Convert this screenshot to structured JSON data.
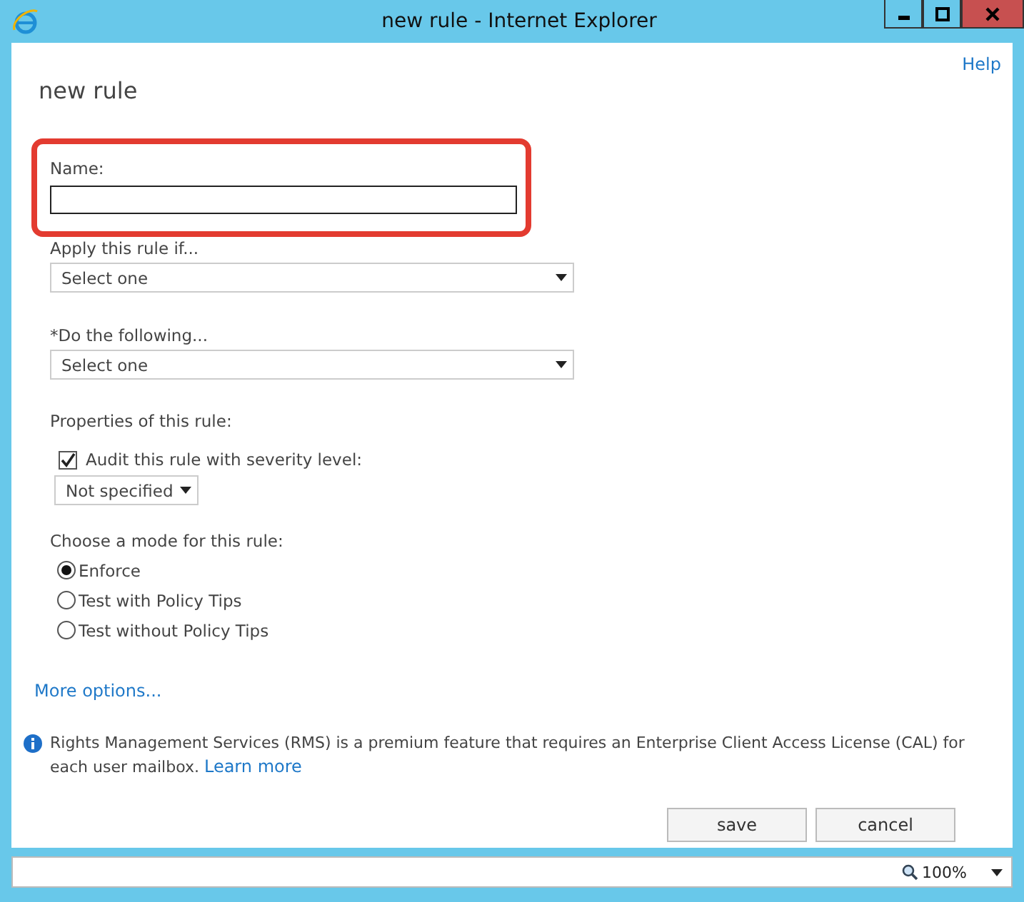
{
  "window": {
    "title": "new rule - Internet Explorer"
  },
  "help_link": "Help",
  "page_title": "new rule",
  "name_field": {
    "label": "Name:",
    "highlighted": true
  },
  "fields": [
    {
      "kind": "select",
      "label": "Apply this rule if...",
      "value": "Select one"
    },
    {
      "kind": "select",
      "label": "*Do the following...",
      "value": "Select one"
    }
  ],
  "properties": {
    "label": "Properties of this rule:",
    "audit": {
      "label": "Audit this rule with severity level:",
      "checked": true
    },
    "severity": {
      "value": "Not specified"
    }
  },
  "mode": {
    "label": "Choose a mode for this rule:",
    "options": [
      {
        "label": "Enforce",
        "selected": true
      },
      {
        "label": "Test with Policy Tips",
        "selected": false
      },
      {
        "label": "Test without Policy Tips",
        "selected": false
      }
    ]
  },
  "more_options": "More options...",
  "notice": {
    "text": "Rights Management Services (RMS) is a premium feature that requires an Enterprise Client Access License (CAL) for each user mailbox.",
    "link": "Learn more"
  },
  "buttons": [
    "save",
    "cancel"
  ],
  "status_bar": {
    "zoom": "100%"
  }
}
